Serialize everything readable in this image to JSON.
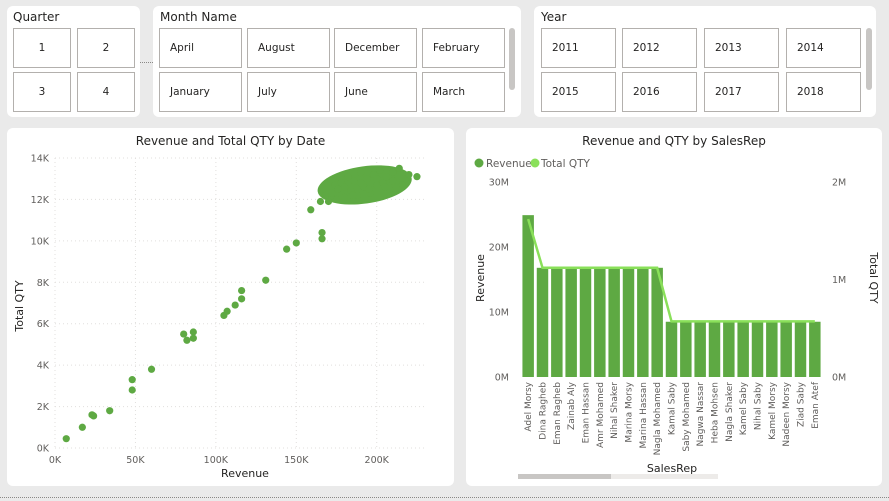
{
  "quarter_slicer": {
    "title": "Quarter",
    "options": [
      "1",
      "2",
      "3",
      "4"
    ]
  },
  "month_slicer": {
    "title": "Month Name",
    "options": [
      "April",
      "August",
      "December",
      "February",
      "January",
      "July",
      "June",
      "March"
    ]
  },
  "year_slicer": {
    "title": "Year",
    "options": [
      "2011",
      "2012",
      "2013",
      "2014",
      "2015",
      "2016",
      "2017",
      "2018"
    ]
  },
  "colors": {
    "series_revenue": "#5ea943",
    "series_qty": "#8ae05a",
    "axis_text": "#605e5c",
    "grid": "#e1dfdd"
  },
  "chart_data": [
    {
      "type": "scatter",
      "title": "Revenue and Total QTY by Date",
      "xlabel": "Revenue",
      "ylabel": "Total QTY",
      "xlim": [
        0,
        230000
      ],
      "ylim": [
        0,
        14000
      ],
      "x_ticks": [
        "0K",
        "50K",
        "100K",
        "150K",
        "200K"
      ],
      "y_ticks": [
        "0K",
        "2K",
        "4K",
        "6K",
        "8K",
        "10K",
        "12K",
        "14K"
      ],
      "grid": true,
      "points": [
        [
          7000,
          450
        ],
        [
          17000,
          1000
        ],
        [
          23000,
          1600
        ],
        [
          24000,
          1550
        ],
        [
          34000,
          1800
        ],
        [
          48000,
          3300
        ],
        [
          48000,
          2800
        ],
        [
          60000,
          3800
        ],
        [
          80000,
          5500
        ],
        [
          82000,
          5200
        ],
        [
          86000,
          5600
        ],
        [
          86000,
          5300
        ],
        [
          105000,
          6400
        ],
        [
          107000,
          6600
        ],
        [
          112000,
          6900
        ],
        [
          116000,
          7200
        ],
        [
          116000,
          7600
        ],
        [
          131000,
          8100
        ],
        [
          144000,
          9600
        ],
        [
          150000,
          9900
        ],
        [
          159000,
          11500
        ],
        [
          166000,
          10400
        ],
        [
          166000,
          10100
        ],
        [
          165000,
          11900
        ],
        [
          168000,
          12200
        ],
        [
          172000,
          12300
        ],
        [
          174000,
          12700
        ],
        [
          176000,
          12500
        ],
        [
          178000,
          12800
        ],
        [
          180000,
          12100
        ],
        [
          182000,
          13100
        ],
        [
          184000,
          12400
        ],
        [
          186000,
          12900
        ],
        [
          188000,
          12200
        ],
        [
          190000,
          13300
        ],
        [
          192000,
          12600
        ],
        [
          194000,
          13000
        ],
        [
          196000,
          12300
        ],
        [
          198000,
          13200
        ],
        [
          200000,
          12700
        ],
        [
          202000,
          13400
        ],
        [
          204000,
          12800
        ],
        [
          206000,
          13100
        ],
        [
          208000,
          12500
        ],
        [
          210000,
          13300
        ],
        [
          212000,
          12900
        ],
        [
          214000,
          13500
        ],
        [
          216000,
          12700
        ],
        [
          218000,
          13000
        ],
        [
          220000,
          13200
        ],
        [
          225000,
          13100
        ],
        [
          170000,
          11900
        ],
        [
          175000,
          12000
        ],
        [
          185000,
          12200
        ],
        [
          195000,
          12500
        ],
        [
          205000,
          12600
        ],
        [
          200000,
          13000
        ],
        [
          190000,
          12800
        ],
        [
          210000,
          12900
        ],
        [
          180000,
          12600
        ]
      ],
      "cluster": {
        "x_range": [
          163000,
          222000
        ],
        "y_range": [
          11800,
          13600
        ]
      }
    },
    {
      "type": "bar",
      "title": "Revenue and QTY by SalesRep",
      "xlabel": "SalesRep",
      "ylabel": "Revenue",
      "y2label": "Total QTY",
      "ylim": [
        0,
        30000000
      ],
      "y2lim": [
        0,
        2000000
      ],
      "y_ticks": [
        "0M",
        "10M",
        "20M",
        "30M"
      ],
      "y2_ticks": [
        "0M",
        "1M",
        "2M"
      ],
      "legend_position": "top-left",
      "categories": [
        "Adel Morsy",
        "Dina Ragheb",
        "Eman Ragheb",
        "Zainab Aly",
        "Eman Hassan",
        "Amr Mohamed",
        "Nihal Shaker",
        "Marina Morsy",
        "Marina Hassan",
        "Nagla Mohamed",
        "Kamal Saby",
        "Saby Mohamed",
        "Nagwa Nassar",
        "Heba Mohsen",
        "Nagla Shaker",
        "Kamel Saby",
        "Nihal Saby",
        "Kamel Morsy",
        "Nadeen Morsy",
        "Ziad Saby",
        "Eman Atef"
      ],
      "series": [
        {
          "name": "Revenue",
          "kind": "bar",
          "values": [
            24900000,
            16800000,
            16800000,
            16800000,
            16800000,
            16800000,
            16800000,
            16800000,
            16800000,
            16800000,
            8500000,
            8500000,
            8500000,
            8500000,
            8500000,
            8500000,
            8500000,
            8500000,
            8500000,
            8500000,
            8500000
          ]
        },
        {
          "name": "Total QTY",
          "kind": "line",
          "values": [
            1620000,
            1120000,
            1120000,
            1120000,
            1120000,
            1120000,
            1120000,
            1120000,
            1120000,
            1120000,
            570000,
            570000,
            570000,
            570000,
            570000,
            570000,
            570000,
            570000,
            570000,
            570000,
            570000
          ]
        }
      ]
    }
  ]
}
